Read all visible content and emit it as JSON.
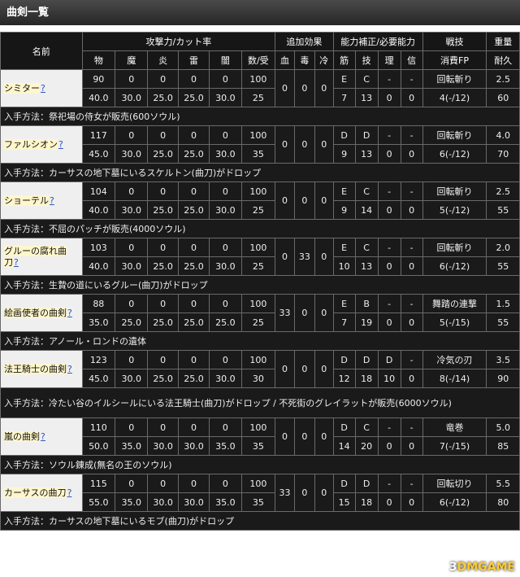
{
  "title": "曲剣一覧",
  "colors": {
    "phys": "#eeeeee",
    "magic": "#22dd55",
    "fire": "#ff8833",
    "lightning": "#ffee22",
    "dark": "#cc55ee"
  },
  "headers": {
    "name": "名前",
    "attack": "攻撃力/カット率",
    "extra": "追加効果",
    "stats": "能力補正/必要能力",
    "skill": "戦技",
    "weight": "重量",
    "phys": "物",
    "magic": "魔",
    "fire": "炎",
    "lightning": "雷",
    "dark": "闇",
    "guard": "数/受",
    "blood": "血",
    "poison": "毒",
    "frost": "冷",
    "str": "筋",
    "dex": "技",
    "int": "理",
    "fth": "信",
    "fp": "消費FP",
    "dur": "耐久"
  },
  "help_mark": "?",
  "weapons": [
    {
      "name": "シミター",
      "atk": [
        "90",
        "0",
        "0",
        "0",
        "0",
        "100"
      ],
      "cut": [
        "40.0",
        "30.0",
        "25.0",
        "25.0",
        "30.0",
        "25"
      ],
      "eff": [
        "0",
        "0",
        "0"
      ],
      "scale": [
        "E",
        "C",
        "-",
        "-"
      ],
      "req": [
        "7",
        "13",
        "0",
        "0"
      ],
      "skill": "回転斬り",
      "fp": "4(-/12)",
      "weight": "2.5",
      "dur": "60",
      "source": "入手方法：祭祀場の侍女が販売(600ソウル)"
    },
    {
      "name": "ファルシオン",
      "atk": [
        "117",
        "0",
        "0",
        "0",
        "0",
        "100"
      ],
      "cut": [
        "45.0",
        "30.0",
        "25.0",
        "25.0",
        "30.0",
        "35"
      ],
      "eff": [
        "0",
        "0",
        "0"
      ],
      "scale": [
        "D",
        "D",
        "-",
        "-"
      ],
      "req": [
        "9",
        "13",
        "0",
        "0"
      ],
      "skill": "回転斬り",
      "fp": "6(-/12)",
      "weight": "4.0",
      "dur": "70",
      "source": "入手方法：カーサスの地下墓にいるスケルトン(曲刀)がドロップ"
    },
    {
      "name": "ショーテル",
      "atk": [
        "104",
        "0",
        "0",
        "0",
        "0",
        "100"
      ],
      "cut": [
        "40.0",
        "30.0",
        "25.0",
        "25.0",
        "30.0",
        "25"
      ],
      "eff": [
        "0",
        "0",
        "0"
      ],
      "scale": [
        "E",
        "C",
        "-",
        "-"
      ],
      "req": [
        "9",
        "14",
        "0",
        "0"
      ],
      "skill": "回転斬り",
      "fp": "5(-/12)",
      "weight": "2.5",
      "dur": "55",
      "source": "入手方法：不屈のパッチが販売(4000ソウル)"
    },
    {
      "name": "グルーの腐れ曲刀",
      "atk": [
        "103",
        "0",
        "0",
        "0",
        "0",
        "100"
      ],
      "cut": [
        "40.0",
        "30.0",
        "25.0",
        "25.0",
        "30.0",
        "25"
      ],
      "eff": [
        "0",
        "33",
        "0"
      ],
      "scale": [
        "E",
        "C",
        "-",
        "-"
      ],
      "req": [
        "10",
        "13",
        "0",
        "0"
      ],
      "skill": "回転斬り",
      "fp": "6(-/12)",
      "weight": "2.0",
      "dur": "55",
      "source": "入手方法：生贄の道にいるグルー(曲刀)がドロップ"
    },
    {
      "name": "絵画使者の曲剣",
      "atk": [
        "88",
        "0",
        "0",
        "0",
        "0",
        "100"
      ],
      "cut": [
        "35.0",
        "25.0",
        "25.0",
        "25.0",
        "25.0",
        "25"
      ],
      "eff": [
        "33",
        "0",
        "0"
      ],
      "scale": [
        "E",
        "B",
        "-",
        "-"
      ],
      "req": [
        "7",
        "19",
        "0",
        "0"
      ],
      "skill": "舞踏の連撃",
      "fp": "5(-/15)",
      "weight": "1.5",
      "dur": "55",
      "source": "入手方法：アノール・ロンドの遺体"
    },
    {
      "name": "法王騎士の曲剣",
      "atk": [
        "123",
        "0",
        "0",
        "0",
        "0",
        "100"
      ],
      "cut": [
        "45.0",
        "30.0",
        "25.0",
        "25.0",
        "30.0",
        "30"
      ],
      "eff": [
        "0",
        "0",
        "0"
      ],
      "scale": [
        "D",
        "D",
        "D",
        "-"
      ],
      "req": [
        "12",
        "18",
        "10",
        "0"
      ],
      "skill": "冷気の刃",
      "fp": "8(-/14)",
      "weight": "3.5",
      "dur": "90",
      "source": "入手方法：冷たい谷のイルシールにいる法王騎士(曲刀)がドロップ / 不死街のグレイラットが販売(6000ソウル)"
    },
    {
      "name": "嵐の曲剣",
      "atk": [
        "110",
        "0",
        "0",
        "0",
        "0",
        "100"
      ],
      "cut": [
        "50.0",
        "35.0",
        "30.0",
        "30.0",
        "35.0",
        "35"
      ],
      "eff": [
        "0",
        "0",
        "0"
      ],
      "scale": [
        "D",
        "C",
        "-",
        "-"
      ],
      "req": [
        "14",
        "20",
        "0",
        "0"
      ],
      "skill": "竜巻",
      "fp": "7(-/15)",
      "weight": "5.0",
      "dur": "85",
      "source": "入手方法：ソウル錬成(無名の王のソウル)"
    },
    {
      "name": "カーサスの曲刀",
      "atk": [
        "115",
        "0",
        "0",
        "0",
        "0",
        "100"
      ],
      "cut": [
        "55.0",
        "35.0",
        "30.0",
        "30.0",
        "35.0",
        "35"
      ],
      "eff": [
        "33",
        "0",
        "0"
      ],
      "scale": [
        "D",
        "D",
        "-",
        "-"
      ],
      "req": [
        "15",
        "18",
        "0",
        "0"
      ],
      "skill": "回転切り",
      "fp": "6(-/12)",
      "weight": "5.5",
      "dur": "80",
      "source": "入手方法：カーサスの地下墓にいるモブ(曲刀)がドロップ"
    }
  ],
  "watermark": {
    "prefix": "3",
    "brand": "DMGAME"
  }
}
